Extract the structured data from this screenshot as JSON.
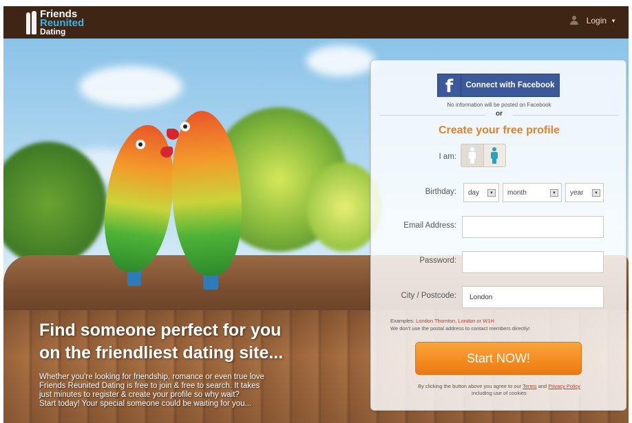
{
  "header": {
    "logo": {
      "line1": "Friends",
      "line2": "Reunited",
      "line3": "Dating"
    },
    "login_label": "Login",
    "login_caret": "▼"
  },
  "hero": {
    "headline_line1": "Find someone perfect for you",
    "headline_line2": "on the friendliest dating site...",
    "blurb_line1": "Whether you're looking for friendship, romance or even true love",
    "blurb_line2": "Friends Reunited Dating is free to join & free to search. It takes",
    "blurb_line3": "just minutes to register & create your profile so why wait?",
    "blurb_line4": "Start today! Your special someone could be waiting for you..."
  },
  "signup": {
    "facebook_icon": "f",
    "facebook_label": "Connect with Facebook",
    "facebook_note": "No information will be posted on Facebook",
    "or": "or",
    "title": "Create your free profile",
    "iam_label": "I am:",
    "birthday_label": "Birthday:",
    "day_value": "day",
    "month_value": "month",
    "year_value": "year",
    "email_label": "Email Address:",
    "email_value": "",
    "password_label": "Password:",
    "password_value": "",
    "city_label": "City / Postcode:",
    "city_value": "London",
    "examples_prefix": "Examples: ",
    "examples_values": "London Thornton, London or W1H",
    "examples_note": "We don't use the postal address to contact members directly!",
    "start_label": "Start NOW!",
    "terms_prefix": "By clicking the button above you agree to our ",
    "terms_link": "Terms",
    "terms_and": " and ",
    "privacy_link": "Privacy Policy",
    "terms_suffix": "including use of cookies"
  },
  "colors": {
    "header_bg": "#3f2614",
    "logo_accent": "#36b7e6",
    "facebook_blue": "#3c5a99",
    "title_orange": "#e3822a",
    "cta_orange": "#f58a1f",
    "link_red": "#c0392b"
  },
  "icons": {
    "login": "user-icon",
    "gender_male": "male-icon",
    "gender_female": "female-icon",
    "dropdown": "dropdown-arrow-icon"
  }
}
